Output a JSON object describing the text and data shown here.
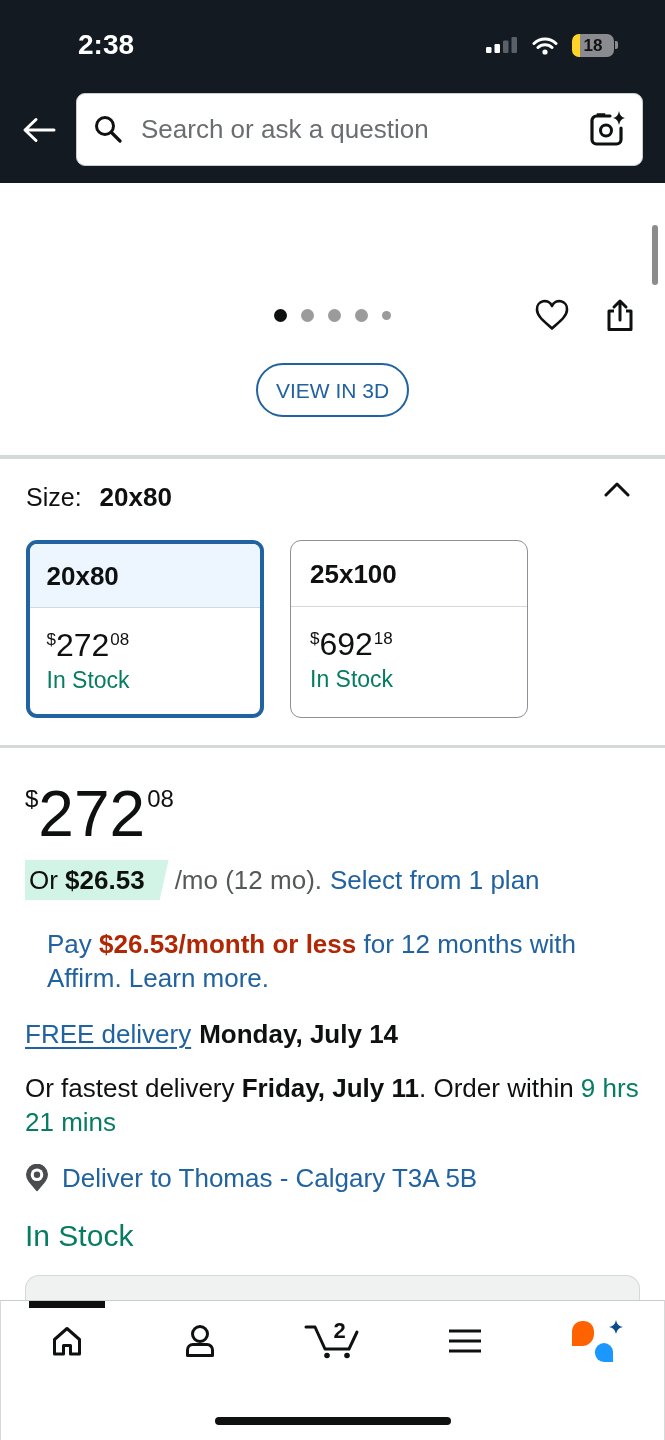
{
  "status_bar": {
    "time": "2:38",
    "battery": "18"
  },
  "search": {
    "placeholder": "Search or ask a question"
  },
  "carousel": [
    {
      "kind": "dot",
      "selected": true
    },
    {
      "kind": "dot",
      "selected": false
    },
    {
      "kind": "dot",
      "selected": false
    },
    {
      "kind": "dot",
      "selected": false
    },
    {
      "kind": "small",
      "selected": false
    }
  ],
  "view_3d_button": "VIEW IN 3D",
  "size": {
    "label": "Size:",
    "value": "20x80",
    "expanded": true,
    "options": [
      {
        "name": "20x80",
        "price": {
          "symbol": "$",
          "whole": "272",
          "fraction": "08"
        },
        "availability": "In Stock",
        "selected": true
      },
      {
        "name": "25x100",
        "price": {
          "symbol": "$",
          "whole": "692",
          "fraction": "18"
        },
        "availability": "In Stock",
        "selected": false
      }
    ]
  },
  "price": {
    "symbol": "$",
    "whole": "272",
    "fraction": "08"
  },
  "installment": {
    "badge": "Or **$26.53**",
    "term": "/mo (12 mo).",
    "link": "Select from 1 plan"
  },
  "affirm": "Pay **$26.53/month or less** for 12 months with Affirm. Learn more.",
  "delivery": {
    "link": "FREE delivery",
    "date": "Monday, July 14"
  },
  "fastest_delivery": {
    "text": "Or fastest delivery **Friday, July 11**. Order within",
    "countdown": "9 hrs 21 mins"
  },
  "location": "Deliver to Thomas - Calgary T3A 5B",
  "availability": "In Stock",
  "bottom_nav": [
    {
      "kind": "home",
      "selected": true
    },
    {
      "kind": "account",
      "selected": false
    },
    {
      "kind": "cart",
      "count": "2",
      "selected": false
    },
    {
      "kind": "menu",
      "selected": false
    },
    {
      "kind": "assistant",
      "selected": false
    }
  ]
}
